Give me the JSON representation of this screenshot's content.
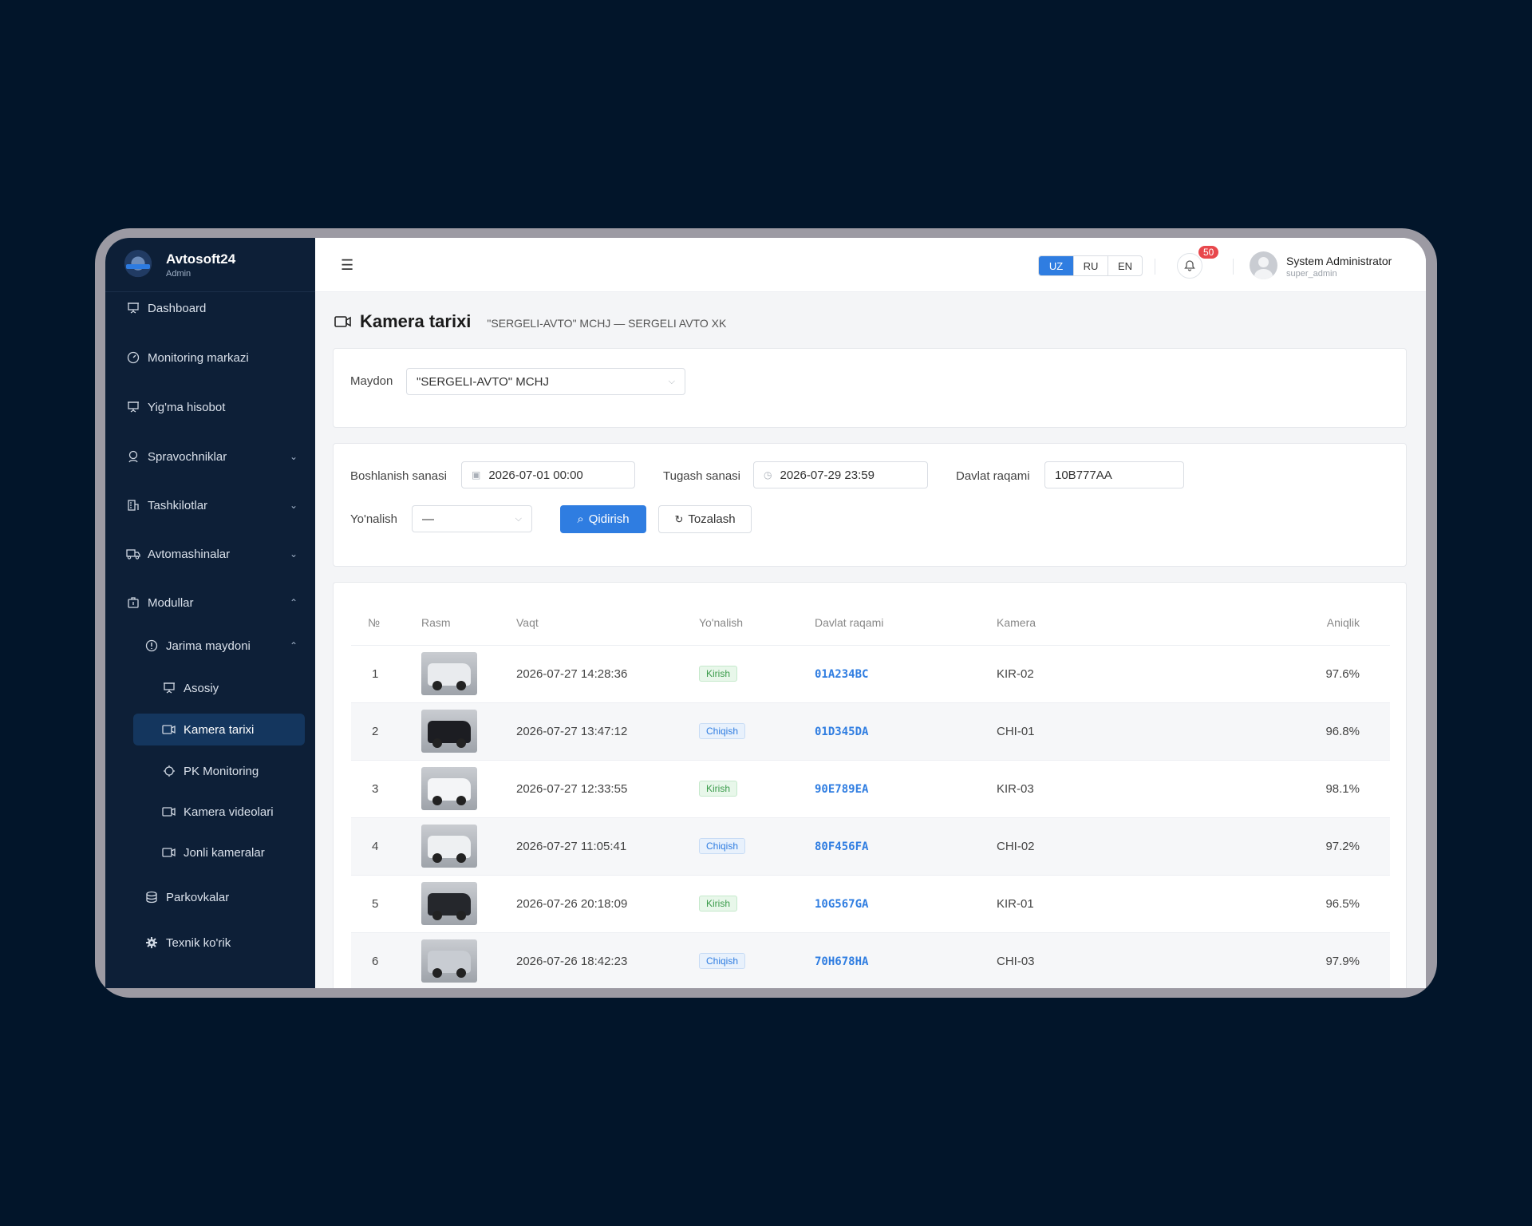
{
  "brand": {
    "name": "Avtosoft24",
    "role": "Admin"
  },
  "sidebar": {
    "items": [
      {
        "label": "Dashboard",
        "icon": "presentation-icon"
      },
      {
        "label": "Monitoring markazi",
        "icon": "gauge-icon"
      },
      {
        "label": "Yig'ma hisobot",
        "icon": "presentation-icon"
      },
      {
        "label": "Spravochniklar",
        "icon": "location-user-icon",
        "chevron": "down"
      },
      {
        "label": "Tashkilotlar",
        "icon": "building-icon",
        "chevron": "down"
      },
      {
        "label": "Avtomashinalar",
        "icon": "truck-icon",
        "chevron": "down"
      },
      {
        "label": "Modullar",
        "icon": "package-icon",
        "chevron": "up"
      },
      {
        "label": "Jarima maydoni",
        "icon": "info-circle-icon",
        "chevron": "up"
      },
      {
        "label": "Asosiy",
        "icon": "presentation-icon"
      },
      {
        "label": "Kamera tarixi",
        "icon": "video-camera-icon",
        "active": true
      },
      {
        "label": "PK Monitoring",
        "icon": "chip-icon"
      },
      {
        "label": "Kamera videolari",
        "icon": "video-camera-icon"
      },
      {
        "label": "Jonli kameralar",
        "icon": "video-camera-icon"
      },
      {
        "label": "Parkovkalar",
        "icon": "database-icon"
      },
      {
        "label": "Texnik ko'rik",
        "icon": "gear-icon"
      }
    ]
  },
  "header": {
    "languages": [
      "UZ",
      "RU",
      "EN"
    ],
    "active_language": "UZ",
    "notifications": "50",
    "user_name": "System Administrator",
    "user_role": "super_admin"
  },
  "page": {
    "title": "Kamera tarixi",
    "subtitle": "\"SERGELI-AVTO\" MCHJ — SERGELI AVTO XK"
  },
  "filters": {
    "field_label": "Maydon",
    "field_value": "\"SERGELI-AVTO\" MCHJ",
    "start_label": "Boshlanish sanasi",
    "start_value": "2026-07-01 00:00",
    "end_label": "Tugash sanasi",
    "end_value": "2026-07-29 23:59",
    "plate_label": "Davlat raqami",
    "plate_value": "10B777AA",
    "direction_label": "Yo'nalish",
    "direction_value": "—",
    "search_label": "Qidirish",
    "clear_label": "Tozalash"
  },
  "table": {
    "headers": [
      "№",
      "Rasm",
      "Vaqt",
      "Yo'nalish",
      "Davlat raqami",
      "Kamera",
      "Aniqlik"
    ],
    "rows": [
      {
        "no": "1",
        "time": "2026-07-27 14:28:36",
        "direction": "Kirish",
        "plate": "01A234BC",
        "camera": "KIR-02",
        "accuracy": "97.6%",
        "car_color": "#e9ebee"
      },
      {
        "no": "2",
        "time": "2026-07-27 13:47:12",
        "direction": "Chiqish",
        "plate": "01D345DA",
        "camera": "CHI-01",
        "accuracy": "96.8%",
        "car_color": "#1c1d22"
      },
      {
        "no": "3",
        "time": "2026-07-27 12:33:55",
        "direction": "Kirish",
        "plate": "90E789EA",
        "camera": "KIR-03",
        "accuracy": "98.1%",
        "car_color": "#f4f5f7"
      },
      {
        "no": "4",
        "time": "2026-07-27 11:05:41",
        "direction": "Chiqish",
        "plate": "80F456FA",
        "camera": "CHI-02",
        "accuracy": "97.2%",
        "car_color": "#eef0f2"
      },
      {
        "no": "5",
        "time": "2026-07-26 20:18:09",
        "direction": "Kirish",
        "plate": "10G567GA",
        "camera": "KIR-01",
        "accuracy": "96.5%",
        "car_color": "#25272c"
      },
      {
        "no": "6",
        "time": "2026-07-26 18:42:23",
        "direction": "Chiqish",
        "plate": "70H678HA",
        "camera": "CHI-03",
        "accuracy": "97.9%",
        "car_color": "#c8ccd2"
      }
    ]
  }
}
